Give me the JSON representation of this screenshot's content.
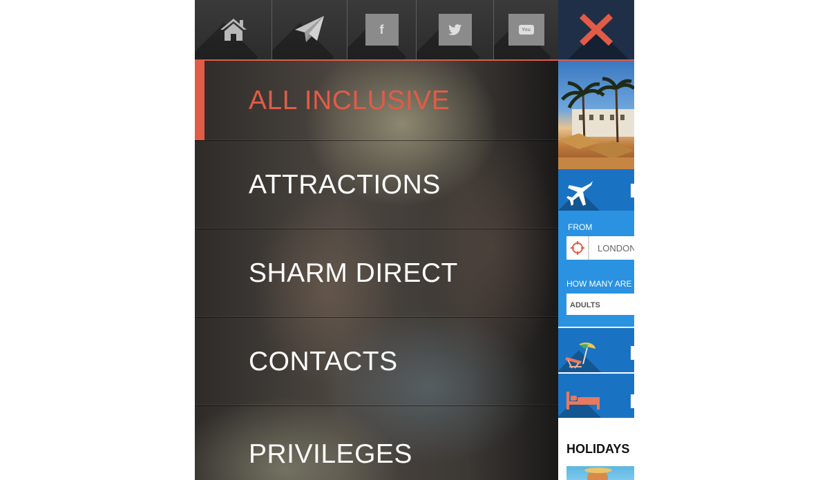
{
  "topbar": {
    "icons": [
      "home-icon",
      "paper-plane-icon",
      "facebook-icon",
      "twitter-icon",
      "youtube-icon"
    ],
    "facebook_letter": "f",
    "youtube_text": "You"
  },
  "menu": {
    "items": [
      {
        "label": "ALL INCLUSIVE",
        "active": true
      },
      {
        "label": "ATTRACTIONS",
        "active": false
      },
      {
        "label": "SHARM DIRECT",
        "active": false
      },
      {
        "label": "CONTACTS",
        "active": false
      },
      {
        "label": "PRIVILEGES",
        "active": false
      }
    ]
  },
  "app": {
    "close_icon": "close-icon",
    "search": {
      "from_label": "FROM",
      "from_value": "LONDON",
      "how_many_label": "HOW MANY ARE",
      "adults_label": "ADULTS"
    },
    "holidays_heading": "HOLIDAYS"
  },
  "colors": {
    "accent": "#e25b46",
    "blue_dark": "#1a73c2",
    "blue_panel": "#2a92e0",
    "navy": "#1f2f48"
  }
}
